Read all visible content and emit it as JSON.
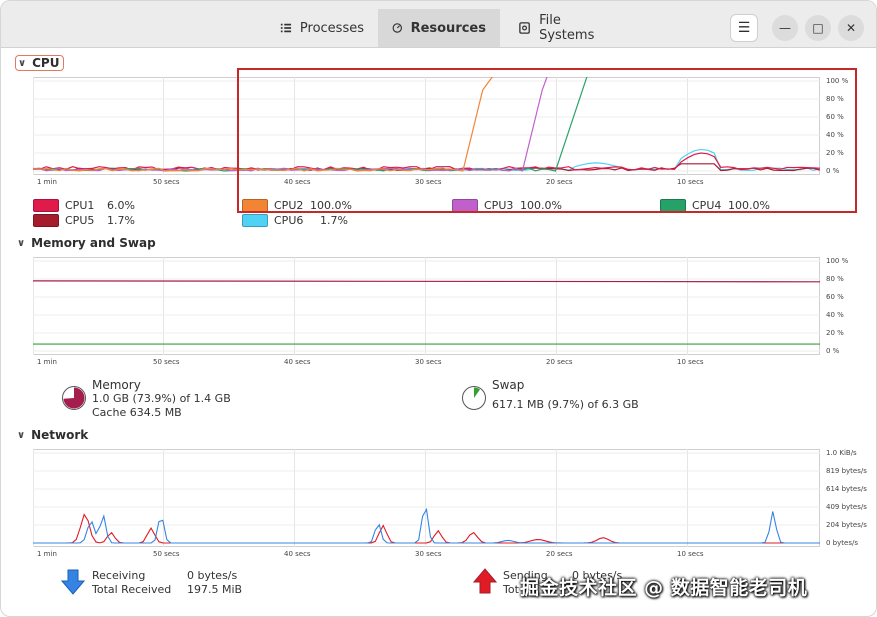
{
  "tabs": [
    {
      "label": "Processes",
      "icon": "list-icon"
    },
    {
      "label": "Resources",
      "icon": "gauge-icon"
    },
    {
      "label": "File Systems",
      "icon": "disk-icon"
    }
  ],
  "window_buttons": {
    "menu": "☰",
    "minimize": "—",
    "maximize": "□",
    "close": "✕"
  },
  "cpu": {
    "title": "CPU",
    "x_ticks": [
      "1 min",
      "50 secs",
      "40 secs",
      "30 secs",
      "20 secs",
      "10 secs"
    ],
    "y_ticks": [
      "100 %",
      "80 %",
      "60 %",
      "40 %",
      "20 %",
      "0 %"
    ],
    "legend": [
      {
        "name": "CPU1",
        "value": "6.0%",
        "color": "#e01b4c"
      },
      {
        "name": "CPU2",
        "value": "100.0%",
        "color": "#f28534"
      },
      {
        "name": "CPU3",
        "value": "100.0%",
        "color": "#c061cb"
      },
      {
        "name": "CPU4",
        "value": "100.0%",
        "color": "#26a269"
      },
      {
        "name": "CPU5",
        "value": "1.7%",
        "color": "#a51d2d"
      },
      {
        "name": "CPU6",
        "value": "1.7%",
        "color": "#4fd2f5"
      }
    ]
  },
  "memory": {
    "title": "Memory and Swap",
    "x_ticks": [
      "1 min",
      "50 secs",
      "40 secs",
      "30 secs",
      "20 secs",
      "10 secs"
    ],
    "y_ticks": [
      "100 %",
      "80 %",
      "60 %",
      "40 %",
      "20 %",
      "0 %"
    ],
    "memory_label": "Memory",
    "memory_usage": "1.0 GB (73.9%) of 1.4 GB",
    "memory_cache": "Cache 634.5 MB",
    "memory_percent": 73.9,
    "swap_label": "Swap",
    "swap_usage": "617.1 MB (9.7%) of 6.3 GB",
    "swap_percent": 9.7,
    "memory_color": "#a51d4c",
    "swap_color": "#33a033"
  },
  "network": {
    "title": "Network",
    "x_ticks": [
      "1 min",
      "50 secs",
      "40 secs",
      "30 secs",
      "20 secs",
      "10 secs"
    ],
    "y_ticks": [
      "1.0 KiB/s",
      "819 bytes/s",
      "614 bytes/s",
      "409 bytes/s",
      "204 bytes/s",
      "0 bytes/s"
    ],
    "receiving_label": "Receiving",
    "receiving_value": "0 bytes/s",
    "total_received_label": "Total Received",
    "total_received_value": "197.5 MiB",
    "sending_label": "Sending",
    "sending_value": "0 bytes/s",
    "total_sent_label": "Tot",
    "receiving_color": "#3584e4",
    "sending_color": "#e01b24"
  },
  "watermark": "掘金技术社区 @ 数据智能老司机"
}
